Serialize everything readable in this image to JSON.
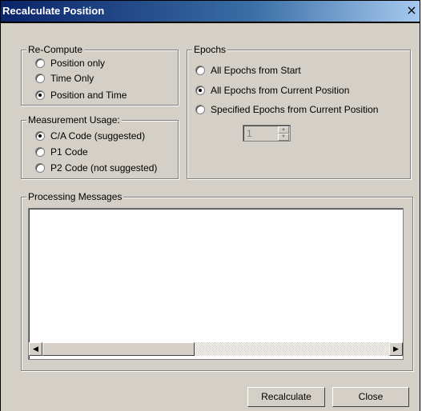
{
  "window": {
    "title": "Recalculate Position",
    "close_glyph": "×"
  },
  "recompute": {
    "legend": "Re-Compute",
    "options": [
      {
        "label": "Position only",
        "checked": false
      },
      {
        "label": "Time Only",
        "checked": false
      },
      {
        "label": "Position and Time",
        "checked": true
      }
    ]
  },
  "measurement": {
    "legend": "Measurement Usage:",
    "options": [
      {
        "label": "C/A Code (suggested)",
        "checked": true
      },
      {
        "label": "P1 Code",
        "checked": false
      },
      {
        "label": "P2 Code (not suggested)",
        "checked": false
      }
    ]
  },
  "epochs": {
    "legend": "Epochs",
    "options": [
      {
        "label": "All Epochs from Start",
        "checked": false
      },
      {
        "label": "All Epochs from Current Position",
        "checked": true
      },
      {
        "label": "Specified Epochs from Current Position",
        "checked": false
      }
    ],
    "spinner_value": "1"
  },
  "messages": {
    "legend": "Processing Messages"
  },
  "buttons": {
    "recalculate": "Recalculate",
    "close": "Close"
  },
  "icons": {
    "scroll_left": "arrow-left-icon",
    "scroll_right": "arrow-right-icon",
    "spin_up": "arrow-up-icon",
    "spin_down": "arrow-down-icon"
  }
}
